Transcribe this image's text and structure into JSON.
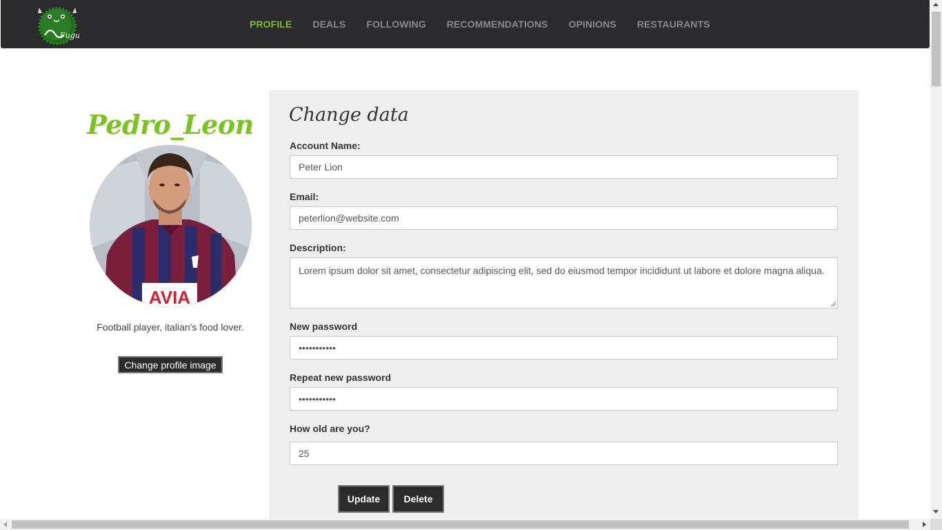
{
  "nav": {
    "items": [
      {
        "label": "PROFILE",
        "active": true
      },
      {
        "label": "DEALS",
        "active": false
      },
      {
        "label": "FOLLOWING",
        "active": false
      },
      {
        "label": "RECOMMENDATIONS",
        "active": false
      },
      {
        "label": "OPINIONS",
        "active": false
      },
      {
        "label": "RESTAURANTS",
        "active": false
      }
    ],
    "logo_text": "Fugu"
  },
  "profile": {
    "username": "Pedro_Leon",
    "bio": "Football player, italian's food lover.",
    "change_image_label": "Change profile image",
    "shirt_text": "AVIA"
  },
  "form": {
    "title": "Change data",
    "account_name_label": "Account Name:",
    "account_name_value": "Peter Lion",
    "email_label": "Email:",
    "email_value": "peterlion@website.com",
    "description_label": "Description:",
    "description_value": "Lorem ipsum dolor sit amet, consectetur adipiscing elit, sed do eiusmod tempor incididunt ut labore et dolore magna aliqua.",
    "new_password_label": "New password",
    "new_password_value": "•••••••••••",
    "repeat_password_label": "Repeat new password",
    "repeat_password_value": "•••••••••••",
    "age_label": "How old are you?",
    "age_value": "25",
    "update_label": "Update",
    "delete_label": "Delete"
  },
  "colors": {
    "accent": "#7ac41f",
    "navbar": "#2b2b2e",
    "panel": "#eeeeee",
    "button": "#2b2b2b"
  }
}
